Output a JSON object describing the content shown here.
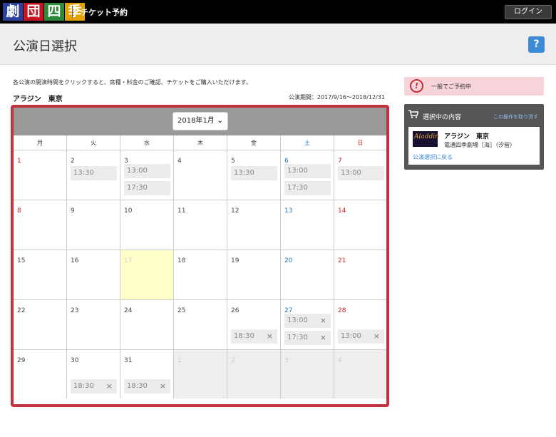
{
  "topbar": {
    "logo_chars": [
      "劇",
      "団",
      "四",
      "季"
    ],
    "app_title": "チケット予約",
    "login_label": "ログイン"
  },
  "header": {
    "title": "公演日選択",
    "help_label": "?"
  },
  "instruction": "各公演の開演時間をクリックすると、席種・料金のご確認、チケットをご購入いただけます。",
  "show_name": "アラジン　東京",
  "period": "公演期間：2017/9/16～2018/12/31",
  "calendar": {
    "month_label": "2018年1月",
    "weekdays": [
      "月",
      "火",
      "水",
      "木",
      "金",
      "土",
      "日"
    ],
    "weeks": [
      [
        {
          "day": "1",
          "type": "sun",
          "slots": []
        },
        {
          "day": "2",
          "type": "",
          "slots": [
            {
              "time": "13:30",
              "x": false
            }
          ]
        },
        {
          "day": "3",
          "type": "",
          "slots": [
            {
              "time": "13:00",
              "x": false
            },
            {
              "time": "17:30",
              "x": false
            }
          ]
        },
        {
          "day": "4",
          "type": "",
          "slots": []
        },
        {
          "day": "5",
          "type": "",
          "slots": [
            {
              "time": "13:30",
              "x": false
            }
          ]
        },
        {
          "day": "6",
          "type": "sat",
          "slots": [
            {
              "time": "13:00",
              "x": false
            },
            {
              "time": "17:30",
              "x": false
            }
          ]
        },
        {
          "day": "7",
          "type": "sun",
          "slots": [
            {
              "time": "13:00",
              "x": false
            }
          ]
        }
      ],
      [
        {
          "day": "8",
          "type": "sun",
          "slots": []
        },
        {
          "day": "9",
          "type": "",
          "slots": []
        },
        {
          "day": "10",
          "type": "",
          "slots": []
        },
        {
          "day": "11",
          "type": "",
          "slots": []
        },
        {
          "day": "12",
          "type": "",
          "slots": []
        },
        {
          "day": "13",
          "type": "sat",
          "slots": []
        },
        {
          "day": "14",
          "type": "sun",
          "slots": []
        }
      ],
      [
        {
          "day": "15",
          "type": "",
          "slots": []
        },
        {
          "day": "16",
          "type": "",
          "slots": []
        },
        {
          "day": "17",
          "type": "today",
          "slots": []
        },
        {
          "day": "18",
          "type": "",
          "slots": []
        },
        {
          "day": "19",
          "type": "",
          "slots": []
        },
        {
          "day": "20",
          "type": "sat",
          "slots": []
        },
        {
          "day": "21",
          "type": "sun",
          "slots": []
        }
      ],
      [
        {
          "day": "22",
          "type": "",
          "slots": []
        },
        {
          "day": "23",
          "type": "",
          "slots": []
        },
        {
          "day": "24",
          "type": "",
          "slots": []
        },
        {
          "day": "25",
          "type": "",
          "slots": []
        },
        {
          "day": "26",
          "type": "",
          "slots": [
            {
              "time": "18:30",
              "x": true
            }
          ]
        },
        {
          "day": "27",
          "type": "sat",
          "slots": [
            {
              "time": "13:00",
              "x": true
            },
            {
              "time": "17:30",
              "x": true
            }
          ]
        },
        {
          "day": "28",
          "type": "sun",
          "slots": [
            {
              "time": "13:00",
              "x": true
            }
          ]
        }
      ],
      [
        {
          "day": "29",
          "type": "",
          "slots": []
        },
        {
          "day": "30",
          "type": "",
          "slots": [
            {
              "time": "18:30",
              "x": true
            }
          ]
        },
        {
          "day": "31",
          "type": "",
          "slots": [
            {
              "time": "18:30",
              "x": true
            }
          ]
        },
        {
          "day": "1",
          "type": "out",
          "slots": []
        },
        {
          "day": "2",
          "type": "out",
          "slots": []
        },
        {
          "day": "3",
          "type": "out",
          "slots": []
        },
        {
          "day": "4",
          "type": "out",
          "slots": []
        }
      ]
    ]
  },
  "side": {
    "notice_text": "一般でご予約中",
    "selection_title": "選択中の内容",
    "clear_link": "この操作を取り消す",
    "show": "アラジン　東京",
    "venue": "電通四季劇場［海］（汐留）",
    "back_link": "公演選択に戻る",
    "thumb_text": "Aladdin"
  },
  "colors": {
    "accent_red": "#c0303d",
    "sat_blue": "#2277bb",
    "sun_red": "#cc2222",
    "today_bg": "#ffffcc",
    "help_blue": "#3d8ad6"
  }
}
